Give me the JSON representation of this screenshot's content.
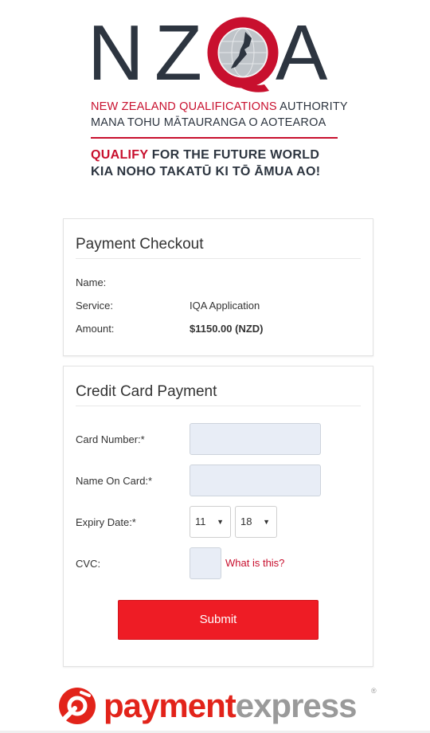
{
  "brand": {
    "logo_text": "NZQA",
    "org_line1_red": "NEW ZEALAND QUALIFICATIONS",
    "org_line1_rest": " AUTHORITY",
    "org_line2": "MANA TOHU MĀTAURANGA O AOTEAROA",
    "tagline1_red": "QUALIFY",
    "tagline1_rest": " FOR THE FUTURE WORLD",
    "tagline2": "KIA NOHO TAKATŪ KI TŌ ĀMUA AO!",
    "red": "#c8102e",
    "dark": "#2d3540"
  },
  "checkout": {
    "title": "Payment Checkout",
    "name_label": "Name:",
    "service_label": "Service:",
    "service_value": "IQA Application",
    "amount_label": "Amount:",
    "amount_value": "$1150.00 (NZD)"
  },
  "card_form": {
    "title": "Credit Card Payment",
    "card_number_label": "Card Number:*",
    "name_on_card_label": "Name On Card:*",
    "expiry_label": "Expiry Date:*",
    "expiry_month": "11",
    "expiry_year": "18",
    "cvc_label": "CVC:",
    "cvc_help": "What is this?",
    "submit_label": "Submit",
    "submit_color": "#ee1c25"
  },
  "footer": {
    "brand_part1": "payment",
    "brand_part2": "express",
    "registered": "®",
    "brand_red": "#e2231a",
    "brand_grey": "#9a9a9a"
  }
}
